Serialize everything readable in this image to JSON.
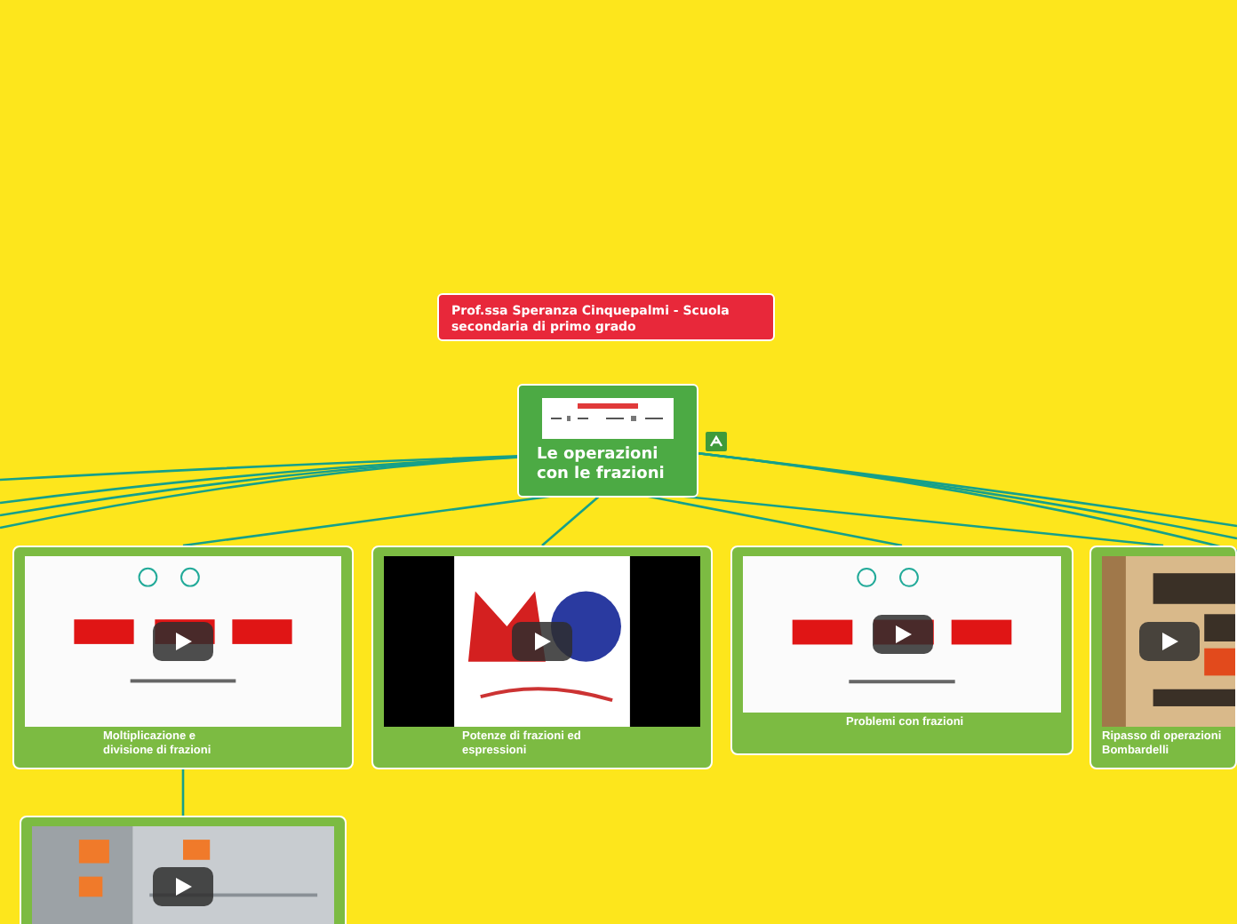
{
  "note": {
    "text": "Prof.ssa Speranza Cinquepalmi  - Scuola\nsecondaria di primo grado"
  },
  "central": {
    "title": "Le operazioni\ncon le frazioni"
  },
  "cards": [
    {
      "title": "Moltiplicazione e\ndivisione di frazioni",
      "video": true
    },
    {
      "title": "Potenze di frazioni ed\nespressioni",
      "video": true
    },
    {
      "title": "Problemi con frazioni",
      "video": true
    },
    {
      "title": "Ripasso di operazioni\nBombardelli",
      "video": true
    },
    {
      "video": true
    }
  ]
}
